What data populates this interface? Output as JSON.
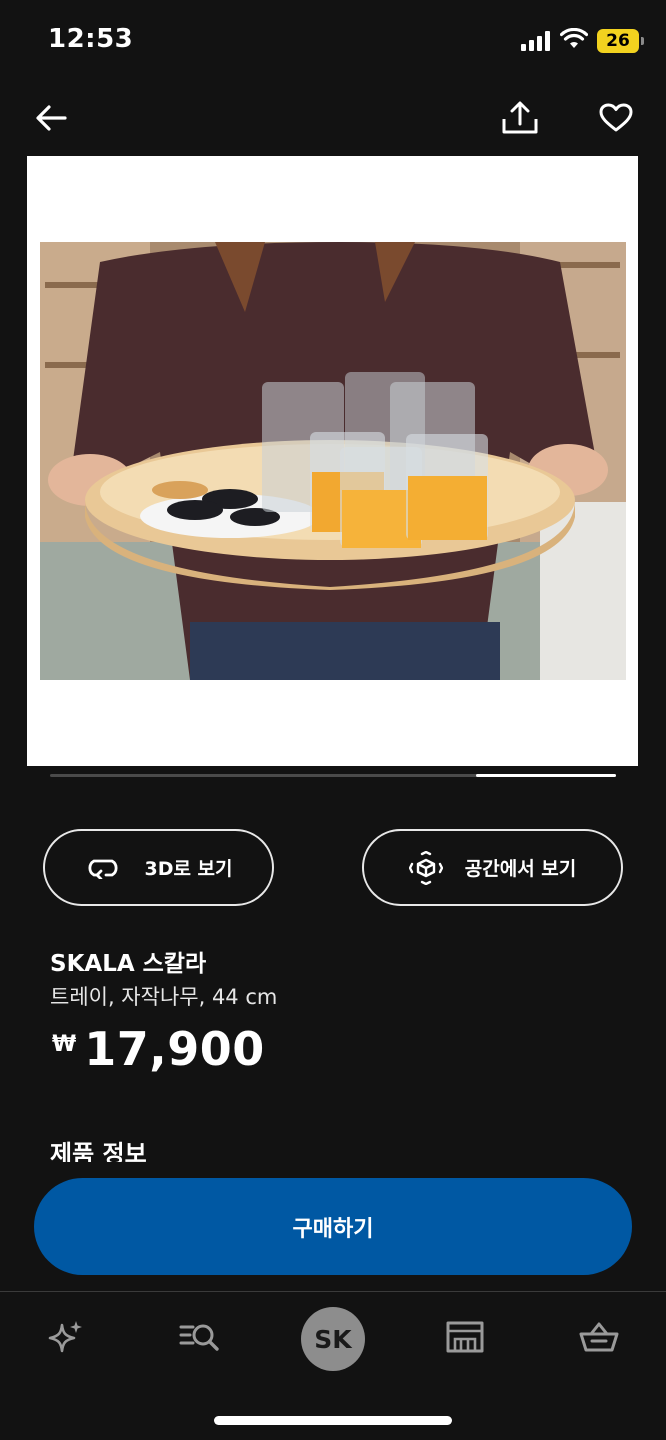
{
  "status_bar": {
    "time": "12:53",
    "battery": "26",
    "battery_color": "#f2d21f",
    "icons": [
      "signal-icon",
      "wifi-icon",
      "battery-icon"
    ]
  },
  "nav": {
    "icons": [
      "back-arrow-icon",
      "share-icon",
      "heart-icon"
    ]
  },
  "gallery": {
    "image_description_icon": "product-photo",
    "scrubber_position": 0.75
  },
  "actions": {
    "view_3d": "3D로 보기",
    "view_in_room": "공간에서 보기"
  },
  "product": {
    "name": "SKALA 스칼라",
    "description": "트레이, 자작나무, 44 cm",
    "currency": "₩",
    "price": "17,900"
  },
  "section": {
    "title": "제품 정보"
  },
  "buy": {
    "label": "구매하기",
    "color": "#0058a3"
  },
  "tabbar": {
    "profile_initials": "SK",
    "icons": [
      "sparkle-icon",
      "search-list-icon",
      "profile-avatar",
      "store-icon",
      "basket-icon"
    ]
  }
}
